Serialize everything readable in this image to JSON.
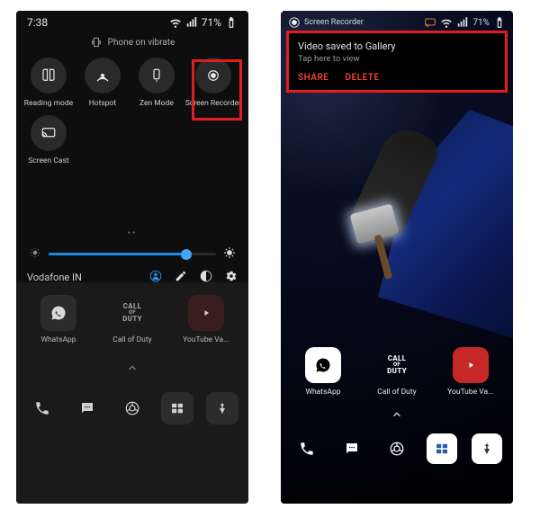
{
  "left": {
    "status": {
      "time": "7:38",
      "battery": "71%"
    },
    "vibrate_label": "Phone on vibrate",
    "tiles": [
      {
        "id": "reading-mode",
        "label": "Reading mode"
      },
      {
        "id": "hotspot",
        "label": "Hotspot"
      },
      {
        "id": "zen-mode",
        "label": "Zen Mode"
      },
      {
        "id": "screen-recorder",
        "label": "Screen Recorder",
        "highlighted": true
      },
      {
        "id": "screen-cast",
        "label": "Screen Cast"
      }
    ],
    "brightness_percent": 82,
    "carrier": "Vodafone IN",
    "home_apps": [
      {
        "id": "whatsapp",
        "label": "WhatsApp"
      },
      {
        "id": "cod",
        "label": "Call of Duty"
      },
      {
        "id": "youtube-vanced",
        "label": "YouTube Va..."
      }
    ],
    "cod_text_top": "CALL",
    "cod_text_bot": "DUTY",
    "dock": [
      "phone",
      "messages",
      "chrome",
      "gallery",
      "pubg"
    ]
  },
  "right": {
    "status": {
      "rec_label": "Screen Recorder",
      "battery": "71%"
    },
    "notification": {
      "title": "Video saved to Gallery",
      "subtitle": "Tap here to view",
      "action_share": "SHARE",
      "action_delete": "DELETE"
    },
    "home_apps": [
      {
        "id": "whatsapp",
        "label": "WhatsApp"
      },
      {
        "id": "cod",
        "label": "Call of Duty"
      },
      {
        "id": "youtube-vanced",
        "label": "YouTube Va..."
      }
    ],
    "dock": [
      "phone",
      "messages",
      "chrome",
      "gallery",
      "pubg"
    ]
  }
}
